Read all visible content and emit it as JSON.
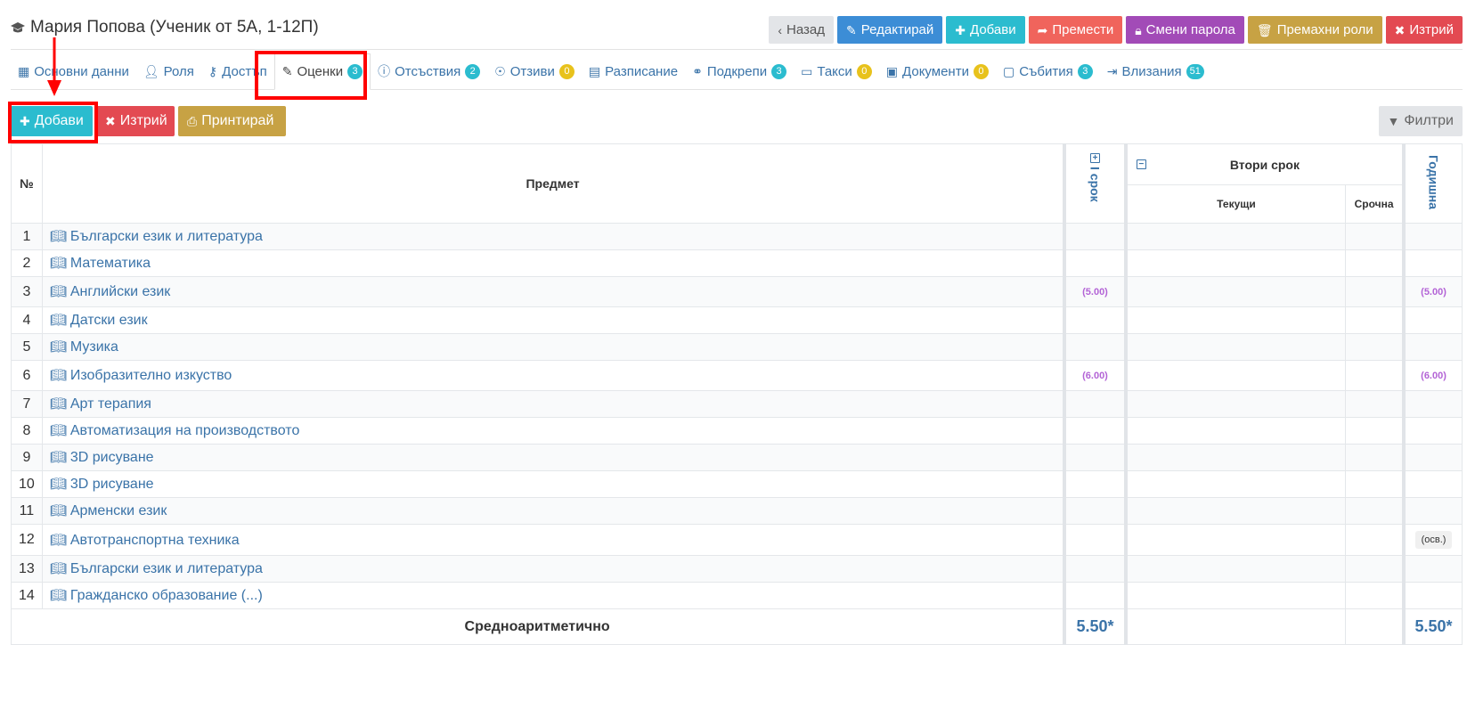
{
  "header": {
    "title": "Мария Попова (Ученик от 5А, 1-12П)",
    "actions": {
      "back": "Назад",
      "edit": "Редактирай",
      "add": "Добави",
      "move": "Премести",
      "change_password": "Смени парола",
      "remove_roles": "Премахни роли",
      "delete": "Изтрий"
    }
  },
  "tabs": [
    {
      "label": "Основни данни",
      "icon": "grid-icon"
    },
    {
      "label": "Роля",
      "icon": "user-plus-icon"
    },
    {
      "label": "Достъп",
      "icon": "key-icon"
    },
    {
      "label": "Оценки",
      "icon": "pencil-icon",
      "badge": "3"
    },
    {
      "label": "Отсъствия",
      "icon": "info-icon",
      "badge": "2"
    },
    {
      "label": "Отзиви",
      "icon": "award-icon",
      "badge": "0"
    },
    {
      "label": "Разписание",
      "icon": "table-icon"
    },
    {
      "label": "Подкрепи",
      "icon": "handshake-icon",
      "badge": "3"
    },
    {
      "label": "Такси",
      "icon": "money-icon",
      "badge": "0"
    },
    {
      "label": "Документи",
      "icon": "id-card-icon",
      "badge": "0"
    },
    {
      "label": "Събития",
      "icon": "calendar-icon",
      "badge": "3"
    },
    {
      "label": "Влизания",
      "icon": "sign-in-icon",
      "badge": "51"
    }
  ],
  "toolbar": {
    "add": "Добави",
    "delete": "Изтрий",
    "print": "Принтирай",
    "filters": "Филтри"
  },
  "table": {
    "col_num": "№",
    "col_subject": "Предмет",
    "col_term1": "I срок",
    "col_term2": "Втори срок",
    "col_current": "Текущи",
    "col_term": "Срочна",
    "col_annual": "Годишна",
    "rows": [
      {
        "n": "1",
        "subject": "Български език и литература",
        "t1": "",
        "annual": ""
      },
      {
        "n": "2",
        "subject": "Математика",
        "t1": "",
        "annual": ""
      },
      {
        "n": "3",
        "subject": "Английски език",
        "t1": "(5.00)",
        "annual": "(5.00)"
      },
      {
        "n": "4",
        "subject": "Датски език",
        "t1": "",
        "annual": ""
      },
      {
        "n": "5",
        "subject": "Музика",
        "t1": "",
        "annual": ""
      },
      {
        "n": "6",
        "subject": "Изобразително изкуство",
        "t1": "(6.00)",
        "annual": "(6.00)"
      },
      {
        "n": "7",
        "subject": "Арт терапия",
        "t1": "",
        "annual": ""
      },
      {
        "n": "8",
        "subject": "Автоматизация на производството",
        "t1": "",
        "annual": ""
      },
      {
        "n": "9",
        "subject": "3D рисуване",
        "t1": "",
        "annual": ""
      },
      {
        "n": "10",
        "subject": "3D рисуване",
        "t1": "",
        "annual": ""
      },
      {
        "n": "11",
        "subject": "Арменски език",
        "t1": "",
        "annual": ""
      },
      {
        "n": "12",
        "subject": "Автотранспортна техника",
        "t1": "",
        "annual": "(осв.)"
      },
      {
        "n": "13",
        "subject": "Български език и литература",
        "t1": "",
        "annual": ""
      },
      {
        "n": "14",
        "subject": "Гражданско образование (...)",
        "t1": "",
        "annual": ""
      }
    ],
    "avg_label": "Средноаритметично",
    "avg_t1": "5.50*",
    "avg_annual": "5.50*"
  },
  "colors": {
    "accent": "#3a73a8",
    "grade": "#b363d6",
    "highlight": "#ff0000"
  }
}
